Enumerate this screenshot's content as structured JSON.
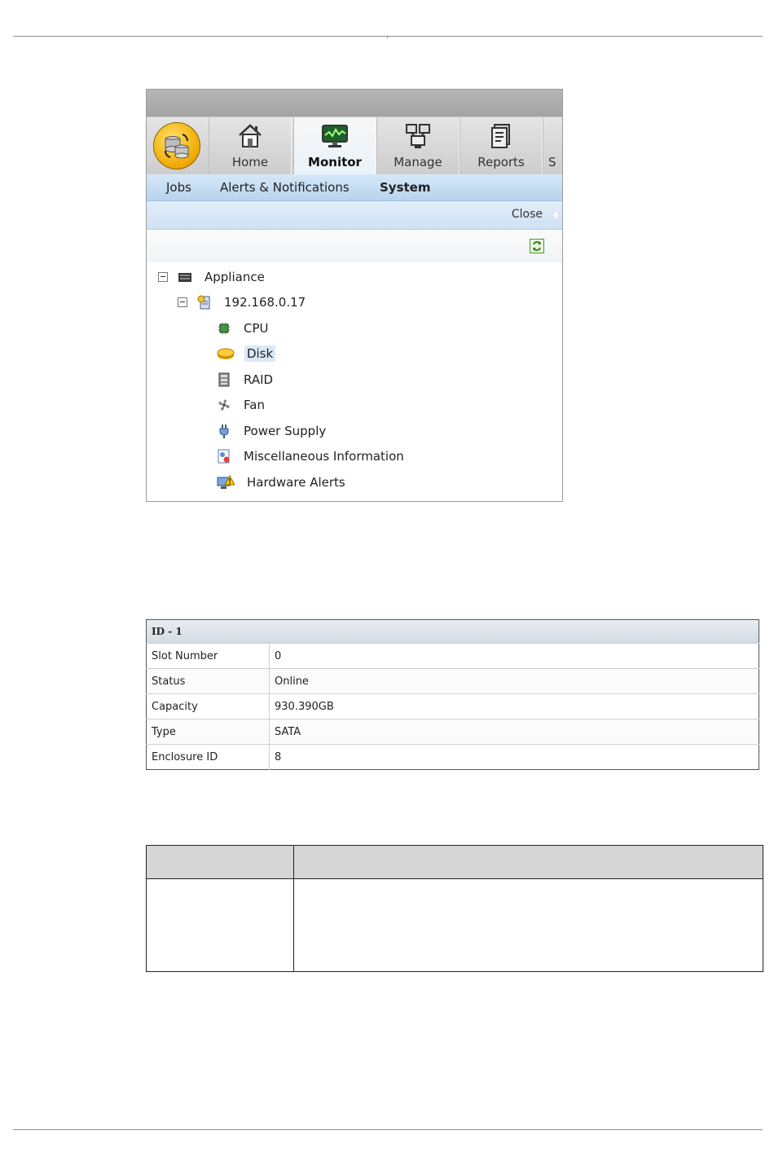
{
  "nav": {
    "tabs": [
      {
        "label": "Home",
        "icon": "home-icon"
      },
      {
        "label": "Monitor",
        "icon": "monitor-icon",
        "active": true
      },
      {
        "label": "Manage",
        "icon": "manage-icon"
      },
      {
        "label": "Reports",
        "icon": "reports-icon"
      }
    ],
    "overflow_label": "S"
  },
  "subnav": {
    "items": [
      {
        "label": "Jobs"
      },
      {
        "label": "Alerts & Notifications"
      },
      {
        "label": "System",
        "active": true
      }
    ]
  },
  "panel": {
    "close_label": "Close"
  },
  "tree": {
    "root": {
      "label": "Appliance",
      "icon": "appliance-icon"
    },
    "host": {
      "label": "192.168.0.17",
      "icon": "server-icon"
    },
    "children": [
      {
        "label": "CPU",
        "icon": "cpu-icon"
      },
      {
        "label": "Disk",
        "icon": "disk-icon",
        "selected": true
      },
      {
        "label": "RAID",
        "icon": "raid-icon"
      },
      {
        "label": "Fan",
        "icon": "fan-icon"
      },
      {
        "label": "Power Supply",
        "icon": "power-supply-icon"
      },
      {
        "label": "Miscellaneous Information",
        "icon": "misc-info-icon"
      },
      {
        "label": "Hardware Alerts",
        "icon": "hardware-alert-icon"
      }
    ]
  },
  "disk_info": {
    "title": "ID - 1",
    "rows": [
      {
        "label": "Slot Number",
        "value": "0"
      },
      {
        "label": "Status",
        "value": "Online"
      },
      {
        "label": "Capacity",
        "value": "930.390GB"
      },
      {
        "label": "Type",
        "value": "SATA"
      },
      {
        "label": "Enclosure ID",
        "value": "8"
      }
    ]
  },
  "colors": {
    "accent_blue": "#b7d3ee",
    "logo_gold": "#f0a800",
    "selection": "#dbe8f5"
  }
}
